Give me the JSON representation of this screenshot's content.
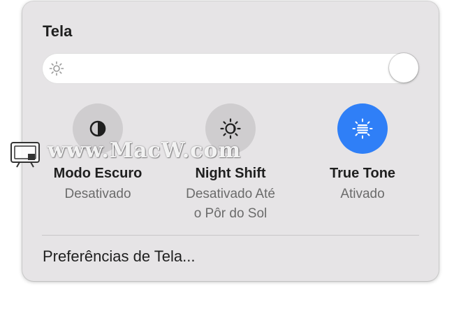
{
  "panel": {
    "title": "Tela",
    "brightness": {
      "level": 1.0,
      "icon": "sun-icon"
    },
    "toggles": [
      {
        "name": "Modo Escuro",
        "status": "Desativado",
        "icon": "dark-mode-icon",
        "active": false
      },
      {
        "name": "Night Shift",
        "status_line1": "Desativado Até",
        "status_line2": "o Pôr do Sol",
        "icon": "night-shift-icon",
        "active": false
      },
      {
        "name": "True Tone",
        "status": "Ativado",
        "icon": "true-tone-icon",
        "active": true
      }
    ],
    "preferences_label": "Preferências de Tela..."
  },
  "watermark": {
    "text": "www.MacW.com"
  },
  "colors": {
    "panel_bg": "#e6e4e6",
    "inactive_toggle": "#cfcdcf",
    "active_toggle": "#2f7ff7"
  }
}
